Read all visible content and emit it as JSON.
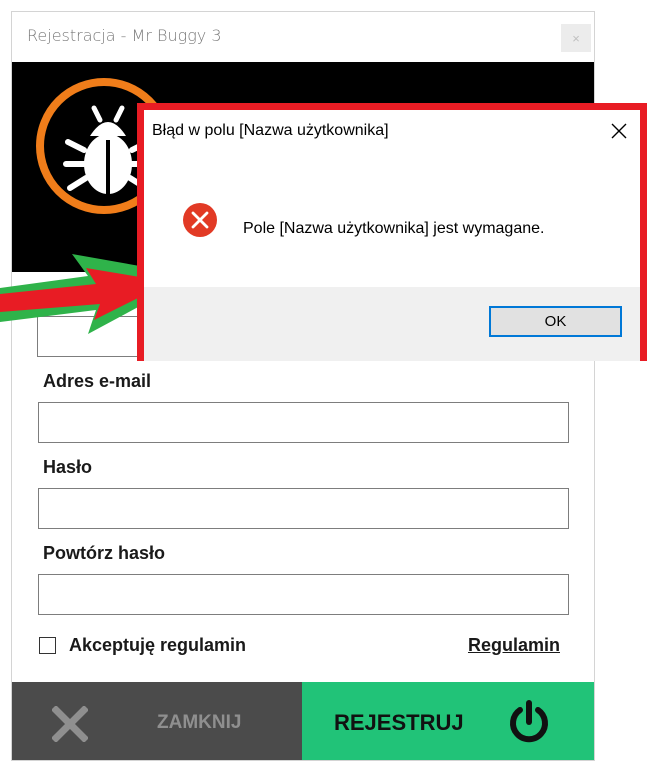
{
  "window": {
    "title": "Rejestracja - Mr Buggy 3",
    "close_glyph": "×"
  },
  "logo": {
    "icon": "bug-icon",
    "ring_color": "#f07d1a"
  },
  "form": {
    "email_label": "Adres e-mail",
    "password_label": "Hasło",
    "repeat_password_label": "Powtórz hasło",
    "email_value": "",
    "password_value": "",
    "repeat_password_value": "",
    "accept_terms_label": "Akceptuję regulamin",
    "accept_terms_checked": false,
    "terms_link": "Regulamin"
  },
  "buttons": {
    "close_label": "ZAMKNIJ",
    "register_label": "REJESTRUJ",
    "close_color": "#4b4b4b",
    "register_color": "#21c378"
  },
  "dialog": {
    "title": "Błąd w polu [Nazwa użytkownika]",
    "message": "Pole [Nazwa użytkownika] jest wymagane.",
    "ok_label": "OK",
    "icon": "error-icon",
    "highlight_color": "#e81c24"
  },
  "annotation": {
    "icon": "arrow-icon",
    "colors": [
      "#e81c24",
      "#2fb34a"
    ]
  }
}
